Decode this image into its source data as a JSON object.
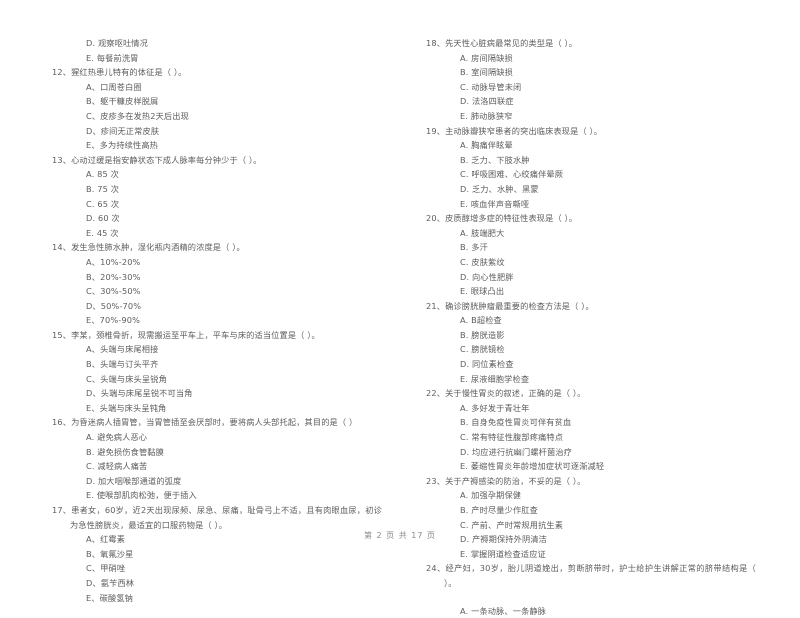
{
  "document": {
    "type": "exam-paper",
    "language": "zh-CN",
    "footer": "第 2 页 共 17 页"
  },
  "left_column": {
    "leading_options": [
      "D. 观察呕吐情况",
      "E. 每餐前洗胃"
    ],
    "questions": [
      {
        "number": "12、",
        "stem": "猩红热患儿特有的体征是（    ）。",
        "options": [
          "A、口周苍白圈",
          "B、躯干糠皮样脱屑",
          "C、皮疹多在发热2天后出现",
          "D、疹间无正常皮肤",
          "E、多为持续性高热"
        ]
      },
      {
        "number": "13、",
        "stem": "心动过缓是指安静状态下成人脉率每分钟少于（    ）。",
        "options": [
          "A. 85 次",
          "B. 75 次",
          "C. 65 次",
          "D. 60 次",
          "E. 45 次"
        ]
      },
      {
        "number": "14、",
        "stem": "发生急性肺水肿，湿化瓶内酒精的浓度是（    ）。",
        "options": [
          "A、10%-20%",
          "B、20%-30%",
          "C、30%-50%",
          "D、50%-70%",
          "E、70%-90%"
        ]
      },
      {
        "number": "15、",
        "stem": "李某，颈椎骨折，现需搬运至平车上，平车与床的适当位置是（    ）。",
        "options": [
          "A、头端与床尾相接",
          "B、头端与订头平齐",
          "C、头端与床头呈锐角",
          "D、头端与床尾呈锐不可当角",
          "E、头端与床头呈钝角"
        ]
      },
      {
        "number": "16、",
        "stem": "为昏迷病人插胃管，当胃管插至会厌部时，要将病人头部托起，其目的是（    ）",
        "options": [
          "A. 避免病人恶心",
          "B. 避免损伤食管黏膜",
          "C. 减轻病人痛苦",
          "D. 加大咽喉部通道的弧度",
          "E. 使喉部肌肉松弛，便于插入"
        ]
      },
      {
        "number": "17、",
        "stem": "患者女，60岁，近2天出现尿频、尿急、尿痛，耻骨弓上不适，且有肉眼血尿，初诊为急性膀胱炎，最适宜的口服药物是（    ）。",
        "options": [
          "A、红霉素",
          "B、氧氟沙星",
          "C、甲硝唑",
          "D、氨苄西林",
          "E、碳酸氢钠"
        ]
      }
    ]
  },
  "right_column": {
    "questions": [
      {
        "number": "18、",
        "stem": "先天性心脏病最常见的类型是（    ）。",
        "options": [
          "A.  房间隔缺损",
          "B.  室间隔缺损",
          "C.  动脉导管未闭",
          "D.  法洛四联症",
          "E.  肺动脉狭窄"
        ]
      },
      {
        "number": "19、",
        "stem": "主动脉瓣狭窄患者的突出临床表现是（    ）。",
        "options": [
          "A. 胸痛伴眩晕",
          "B. 乏力、下肢水肿",
          "C. 呼吸困难、心绞痛伴晕厥",
          "D. 乏力、水肿、黑蒙",
          "E. 咳血伴声音嘶哑"
        ]
      },
      {
        "number": "20、",
        "stem": "皮质醇增多症的特征性表现是（    ）。",
        "options": [
          "A.  肢端肥大",
          "B.  多汗",
          "C.  皮肤紫纹",
          "D.  向心性肥胖",
          "E.  眼球凸出"
        ]
      },
      {
        "number": "21、",
        "stem": "确诊膀胱肿瘤最重要的检查方法是（    ）。",
        "options": [
          "A. B超检查",
          "B. 膀胱造影",
          "C. 膀胱镜检",
          "D. 同位素检查",
          "E. 尿液细胞学检查"
        ]
      },
      {
        "number": "22、",
        "stem": "关于慢性胃炎的叙述，正确的是（    ）。",
        "options": [
          "A. 多好发于青壮年",
          "B. 自身免疫性胃炎可伴有贫血",
          "C. 常有特征性腹部疼痛特点",
          "D. 均应进行抗幽门螺杆菌治疗",
          "E. 萎缩性胃炎年龄增加症状可逐渐减轻"
        ]
      },
      {
        "number": "23、",
        "stem": "关于产褥感染的防治，不妥的是（    ）。",
        "options": [
          "A.  加强孕期保健",
          "B.  产时尽量少作肛查",
          "C.  产前、产时常规用抗生素",
          "D.  产褥期保持外阴清洁",
          "E.  掌握阴道检查适应证"
        ]
      },
      {
        "number": "24、",
        "stem": "经产妇，30岁，胎儿阴道娩出，剪断脐带时，护士给护生讲解正常的脐带结构是（    ）。",
        "options": [
          "A.  一条动脉、一条静脉"
        ]
      }
    ]
  }
}
